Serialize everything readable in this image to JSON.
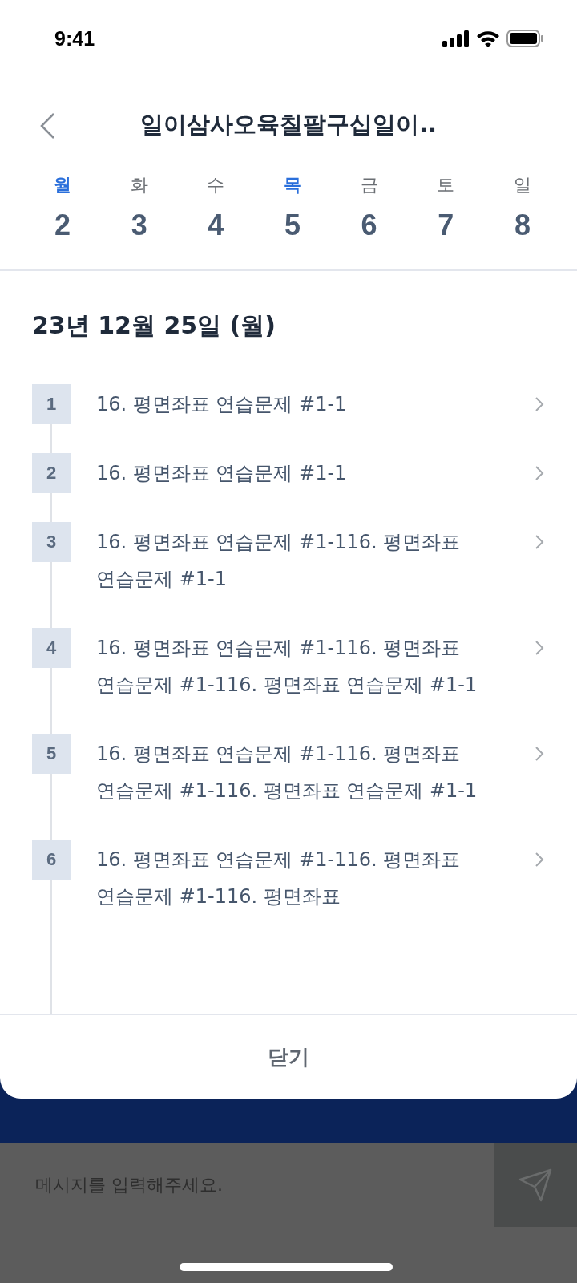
{
  "status_bar": {
    "time": "9:41"
  },
  "header": {
    "title": "일이삼사오육칠팔구십일이.."
  },
  "week": [
    {
      "day": "월",
      "date": "2",
      "highlight": true
    },
    {
      "day": "화",
      "date": "3",
      "highlight": false
    },
    {
      "day": "수",
      "date": "4",
      "highlight": false
    },
    {
      "day": "목",
      "date": "5",
      "highlight": true
    },
    {
      "day": "금",
      "date": "6",
      "highlight": false
    },
    {
      "day": "토",
      "date": "7",
      "highlight": false
    },
    {
      "day": "일",
      "date": "8",
      "highlight": false
    }
  ],
  "date_heading": "23년 12월 25일 (월)",
  "lessons": [
    {
      "number": "1",
      "title": "16. 평면좌표 연습문제 #1-1"
    },
    {
      "number": "2",
      "title": "16. 평면좌표 연습문제 #1-1"
    },
    {
      "number": "3",
      "title": "16. 평면좌표 연습문제 #1-116. 평면좌표 연습문제 #1-1"
    },
    {
      "number": "4",
      "title": "16. 평면좌표 연습문제 #1-116. 평면좌표 연습문제 #1-116. 평면좌표 연습문제 #1-1"
    },
    {
      "number": "5",
      "title": "16. 평면좌표 연습문제 #1-116. 평면좌표 연습문제 #1-116. 평면좌표 연습문제 #1-1"
    },
    {
      "number": "6",
      "title": "16. 평면좌표 연습문제 #1-116. 평면좌표 연습문제 #1-116. 평면좌표"
    }
  ],
  "close_button": "닫기",
  "message_input": {
    "placeholder": "메시지를 입력해주세요."
  }
}
